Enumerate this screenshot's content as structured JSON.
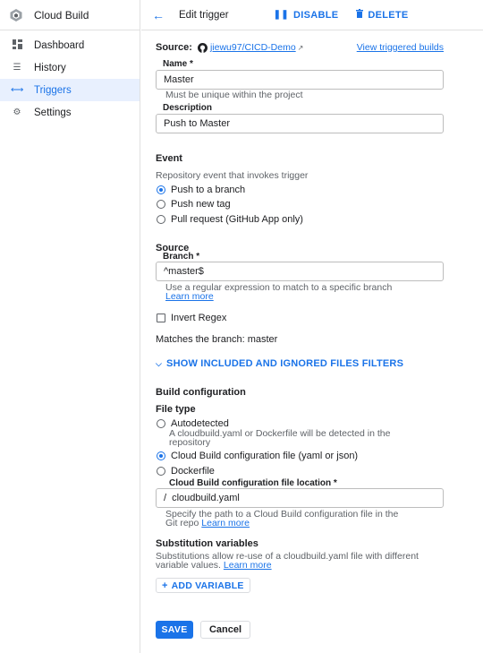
{
  "app": {
    "title": "Cloud Build"
  },
  "sidebar": {
    "items": [
      {
        "label": "Dashboard",
        "icon": "dashboard-icon"
      },
      {
        "label": "History",
        "icon": "list-icon"
      },
      {
        "label": "Triggers",
        "icon": "arrow-icon",
        "active": true
      },
      {
        "label": "Settings",
        "icon": "gear-icon"
      }
    ]
  },
  "topbar": {
    "title": "Edit trigger",
    "disable_label": "DISABLE",
    "delete_label": "DELETE"
  },
  "source": {
    "label": "Source:",
    "repo": "jiewu97/CICD-Demo",
    "view_builds": "View triggered builds"
  },
  "name": {
    "label": "Name *",
    "value": "Master",
    "helper": "Must be unique within the project"
  },
  "description": {
    "label": "Description",
    "value": "Push to Master"
  },
  "event": {
    "title": "Event",
    "helper": "Repository event that invokes trigger",
    "options": [
      {
        "label": "Push to a branch",
        "selected": true
      },
      {
        "label": "Push new tag",
        "selected": false
      },
      {
        "label": "Pull request (GitHub App only)",
        "selected": false
      }
    ]
  },
  "source_section": {
    "title": "Source",
    "branch_label": "Branch *",
    "branch_value": "^master$",
    "branch_helper": "Use a regular expression to match to a specific branch",
    "learn_more": "Learn more",
    "invert_regex": "Invert Regex",
    "matches": "Matches the branch: master",
    "show_filters": "SHOW INCLUDED AND IGNORED FILES FILTERS"
  },
  "build_config": {
    "title": "Build configuration",
    "file_type": "File type",
    "options": [
      {
        "label": "Autodetected",
        "selected": false,
        "helper_line1": "A cloudbuild.yaml or Dockerfile will be detected in the",
        "helper_line2": "repository"
      },
      {
        "label": "Cloud Build configuration file (yaml or json)",
        "selected": true
      },
      {
        "label": "Dockerfile",
        "selected": false
      }
    ],
    "location_label": "Cloud Build configuration file location *",
    "location_prefix": "/",
    "location_value": "cloudbuild.yaml",
    "location_helper_line1": "Specify the path to a Cloud Build configuration file in the",
    "location_helper_line2": "Git repo",
    "learn_more": "Learn more"
  },
  "substitution": {
    "title": "Substitution variables",
    "helper_line1": "Substitutions allow re-use of a cloudbuild.yaml file with different",
    "helper_line2": "variable values.",
    "learn_more": "Learn more",
    "add_variable": "ADD VARIABLE"
  },
  "actions": {
    "save": "SAVE",
    "cancel": "Cancel"
  },
  "colors": {
    "accent": "#1a73e8",
    "active_bg": "#e8f0fe"
  }
}
